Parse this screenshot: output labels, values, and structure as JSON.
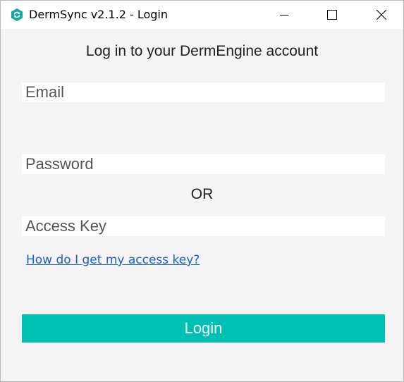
{
  "window": {
    "title": "DermSync v2.1.2 - Login",
    "icon": "dermsync-logo-icon",
    "accent_color": "#00bfb3"
  },
  "login": {
    "heading": "Log in to your DermEngine account",
    "email_placeholder": "Email",
    "password_placeholder": "Password",
    "or_label": "OR",
    "access_key_placeholder": "Access Key",
    "help_link": "How do I get my access key?",
    "login_button": "Login"
  }
}
